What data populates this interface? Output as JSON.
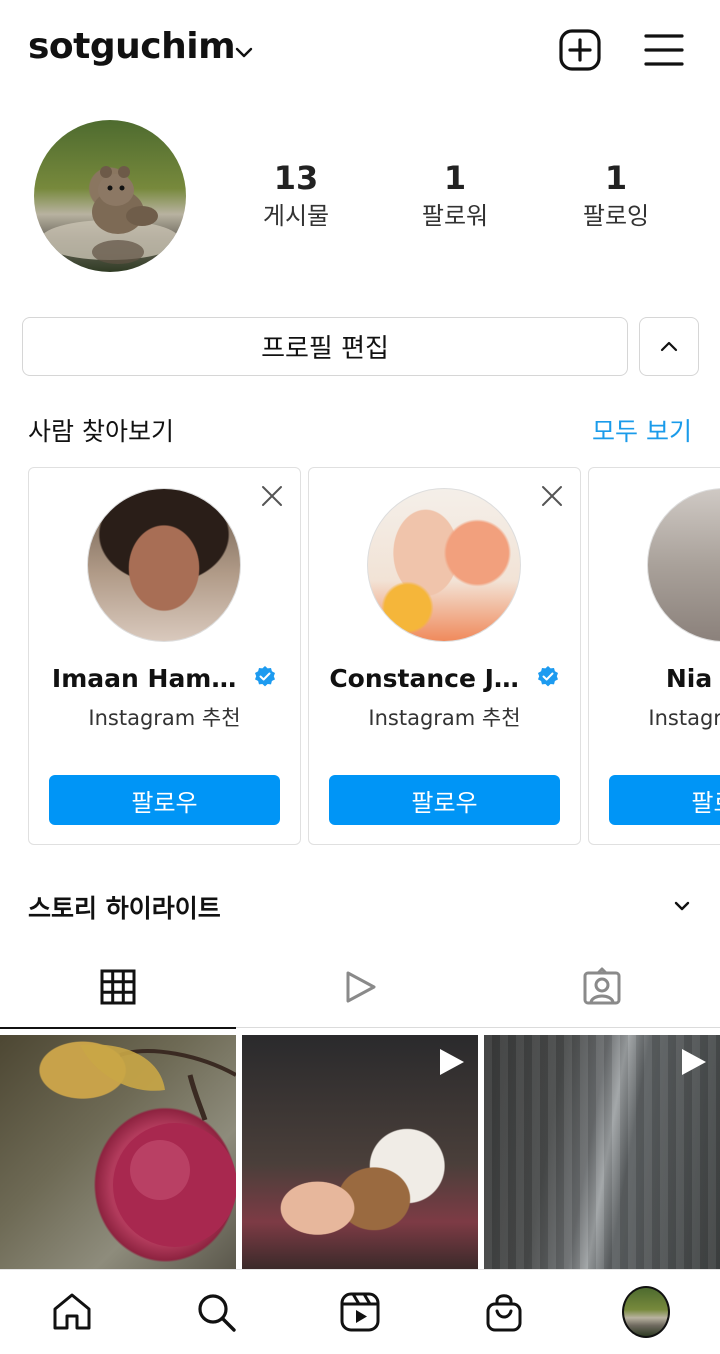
{
  "header": {
    "username": "sotguchim",
    "icons": [
      "chevron-down-icon",
      "plus-square-icon",
      "hamburger-menu-icon"
    ]
  },
  "profile": {
    "avatar": "squirrel-photo",
    "stats": [
      {
        "value": "13",
        "label": "게시물"
      },
      {
        "value": "1",
        "label": "팔로워"
      },
      {
        "value": "1",
        "label": "팔로잉"
      }
    ],
    "edit_label": "프로필 편집",
    "toggle_icon": "chevron-up-icon"
  },
  "discover": {
    "title": "사람 찾아보기",
    "see_all": "모두 보기",
    "cards": [
      {
        "name": "Imaan Ham…",
        "subtitle": "Instagram 추천",
        "follow": "팔로우",
        "verified": true
      },
      {
        "name": "Constance J…",
        "subtitle": "Instagram 추천",
        "follow": "팔로우",
        "verified": true
      },
      {
        "name": "Nia Ram",
        "subtitle": "Instagram 추천",
        "follow": "팔로우",
        "verified": false
      }
    ]
  },
  "highlights": {
    "title": "스토리 하이라이트",
    "toggle_icon": "chevron-down-icon"
  },
  "tabs": [
    {
      "icon": "grid-icon",
      "active": true
    },
    {
      "icon": "reels-play-icon",
      "active": false
    },
    {
      "icon": "tagged-person-icon",
      "active": false
    }
  ],
  "posts": [
    {
      "subject": "red apple with dew",
      "reel": false
    },
    {
      "subject": "puppy with hand",
      "reel": true
    },
    {
      "subject": "city street aerial",
      "reel": true
    }
  ],
  "bottom_nav": [
    "home-icon",
    "search-icon",
    "reels-icon",
    "shop-bag-icon",
    "profile-avatar"
  ],
  "colors": {
    "accent": "#0095f6",
    "link": "#1a9bea",
    "verified": "#1d9bf0"
  }
}
